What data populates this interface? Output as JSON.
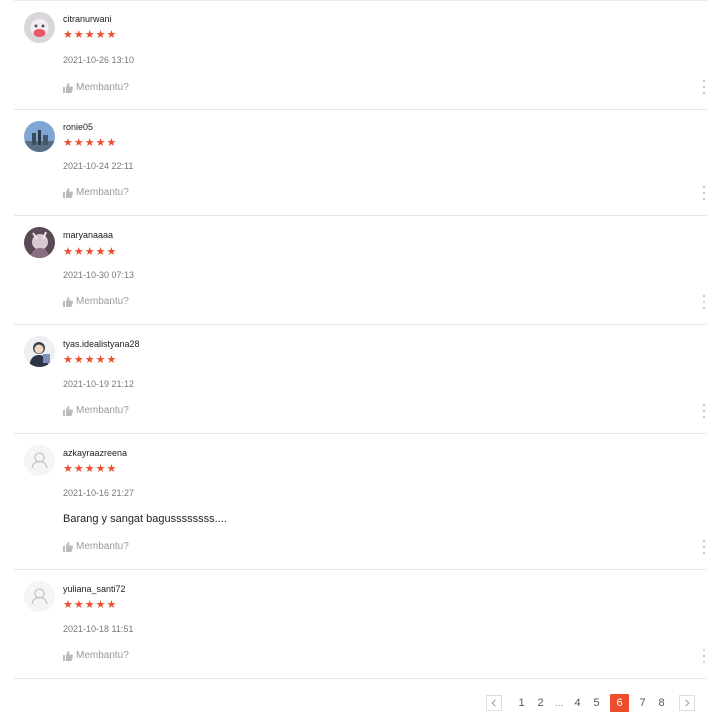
{
  "reviews": [
    {
      "username": "citranurwani",
      "stars": "★★★★★",
      "date": "2021-10-26 13:10",
      "comment": "",
      "helpful": "Membantu?",
      "avatar": "photo-pink"
    },
    {
      "username": "ronie05",
      "stars": "★★★★★",
      "date": "2021-10-24 22:11",
      "comment": "",
      "helpful": "Membantu?",
      "avatar": "photo-sky"
    },
    {
      "username": "maryanaaaa",
      "stars": "★★★★★",
      "date": "2021-10-30 07:13",
      "comment": "",
      "helpful": "Membantu?",
      "avatar": "photo-dark"
    },
    {
      "username": "tyas.idealistyana28",
      "stars": "★★★★★",
      "date": "2021-10-19 21:12",
      "comment": "",
      "helpful": "Membantu?",
      "avatar": "photo-person"
    },
    {
      "username": "azkayraazreena",
      "stars": "★★★★★",
      "date": "2021-10-16 21:27",
      "comment": "Barang y sangat bagussssssss....",
      "helpful": "Membantu?",
      "avatar": "default-user"
    },
    {
      "username": "yuliana_santi72",
      "stars": "★★★★★",
      "date": "2021-10-18 11:51",
      "comment": "",
      "helpful": "Membantu?",
      "avatar": "default-user"
    }
  ],
  "pagination": {
    "pages": [
      "1",
      "2",
      "...",
      "4",
      "5",
      "6",
      "7",
      "8"
    ],
    "current": "6",
    "prev_icon": "chevron-left-icon",
    "next_icon": "chevron-right-icon"
  },
  "colors": {
    "accent": "#ee4d2d",
    "divider": "#e6e6e6",
    "muted": "#999999"
  }
}
